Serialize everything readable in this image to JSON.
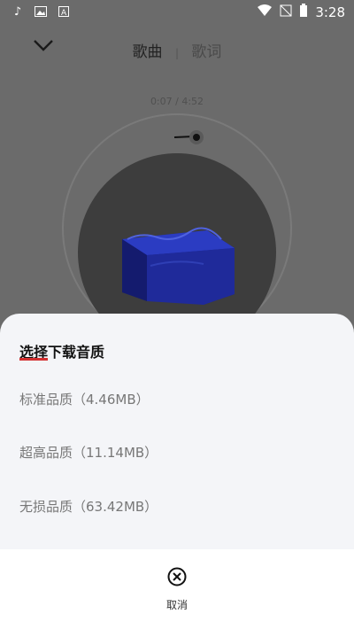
{
  "status_bar": {
    "time": "3:28"
  },
  "player": {
    "tab_song": "歌曲",
    "tab_lyrics": "歌词",
    "position": "0:07",
    "duration": "4:52",
    "timeline_sep": " / "
  },
  "sheet": {
    "title": "选择下载音质",
    "options": [
      {
        "label": "标准品质（4.46MB）"
      },
      {
        "label": "超高品质（11.14MB）"
      },
      {
        "label": "无损品质（63.42MB）"
      }
    ],
    "cancel_label": "取消"
  },
  "colors": {
    "sheet_bg": "#f4f5f8",
    "accent_underline": "#d32f2f",
    "cover_blue": "#1f2a8a"
  }
}
